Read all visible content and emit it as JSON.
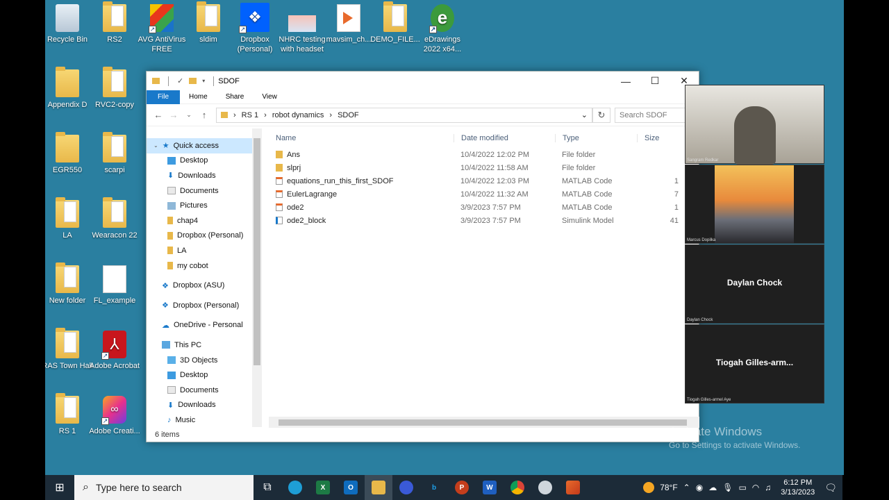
{
  "desktop": {
    "icons": [
      {
        "label": "Recycle Bin",
        "icon": "recycle-bin-icon"
      },
      {
        "label": "RS2",
        "icon": "folder-icon"
      },
      {
        "label": "AVG AntiVirus FREE",
        "icon": "avg-icon"
      },
      {
        "label": "sldim",
        "icon": "folder-icon"
      },
      {
        "label": "Dropbox (Personal)",
        "icon": "dropbox-icon"
      },
      {
        "label": "NHRC testing with headset",
        "icon": "video-icon"
      },
      {
        "label": "mavsim_ch...",
        "icon": "simulink-file-icon"
      },
      {
        "label": "DEMO_FILE...",
        "icon": "folder-icon"
      },
      {
        "label": "eDrawings 2022 x64...",
        "icon": "edrawings-icon"
      },
      {
        "label": "Appendix D",
        "icon": "folder-icon"
      },
      {
        "label": "RVC2-copy",
        "icon": "folder-icon"
      },
      {
        "label": "EGR550",
        "icon": "folder-icon"
      },
      {
        "label": "scarpi",
        "icon": "folder-icon"
      },
      {
        "label": "LA",
        "icon": "folder-icon"
      },
      {
        "label": "Wearacon 22",
        "icon": "folder-icon"
      },
      {
        "label": "New folder",
        "icon": "folder-icon"
      },
      {
        "label": "FL_example",
        "icon": "document-icon"
      },
      {
        "label": "RAS Town Hall",
        "icon": "folder-icon"
      },
      {
        "label": "Adobe Acrobat",
        "icon": "acrobat-icon"
      },
      {
        "label": "RS 1",
        "icon": "folder-icon"
      },
      {
        "label": "Adobe Creati...",
        "icon": "creative-cloud-icon"
      }
    ]
  },
  "explorer": {
    "title": "SDOF",
    "ribbon": {
      "file": "File",
      "home": "Home",
      "share": "Share",
      "view": "View"
    },
    "breadcrumb": [
      "RS 1",
      "robot dynamics",
      "SDOF"
    ],
    "search_placeholder": "Search SDOF",
    "nav": {
      "quick_access": "Quick access",
      "items": [
        "Desktop",
        "Downloads",
        "Documents",
        "Pictures",
        "chap4",
        "Dropbox (Personal)",
        "LA",
        "my cobot"
      ],
      "dropbox_asu": "Dropbox (ASU)",
      "dropbox_personal": "Dropbox (Personal)",
      "onedrive": "OneDrive - Personal",
      "this_pc": "This PC",
      "pc_items": [
        "3D Objects",
        "Desktop",
        "Documents",
        "Downloads",
        "Music"
      ]
    },
    "columns": {
      "name": "Name",
      "date": "Date modified",
      "type": "Type",
      "size": "Size"
    },
    "files": [
      {
        "name": "Ans",
        "date": "10/4/2022 12:02 PM",
        "type": "File folder",
        "size": ""
      },
      {
        "name": "slprj",
        "date": "10/4/2022 11:58 AM",
        "type": "File folder",
        "size": ""
      },
      {
        "name": "equations_run_this_first_SDOF",
        "date": "10/4/2022 12:03 PM",
        "type": "MATLAB Code",
        "size": "1"
      },
      {
        "name": "EulerLagrange",
        "date": "10/4/2022 11:32 AM",
        "type": "MATLAB Code",
        "size": "7"
      },
      {
        "name": "ode2",
        "date": "3/9/2023 7:57 PM",
        "type": "MATLAB Code",
        "size": "1"
      },
      {
        "name": "ode2_block",
        "date": "3/9/2023 7:57 PM",
        "type": "Simulink Model",
        "size": "41"
      }
    ],
    "status": "6 items"
  },
  "video": {
    "tiles": [
      {
        "name": "Sangram Redkar",
        "big": ""
      },
      {
        "name": "Marcus Dopilka",
        "big": ""
      },
      {
        "name": "Daylan Chock",
        "big": "Daylan Chock"
      },
      {
        "name": "Tiogah Gilles-armel Aye",
        "big": "Tiogah  Gilles-arm..."
      }
    ]
  },
  "watermark": {
    "line1": "Activate Windows",
    "line2": "Go to Settings to activate Windows."
  },
  "taskbar": {
    "search_placeholder": "Type here to search",
    "temp": "78°F",
    "time": "6:12 PM",
    "date": "3/13/2023"
  }
}
